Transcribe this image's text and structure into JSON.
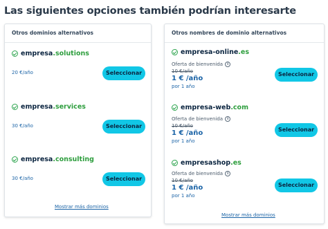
{
  "page": {
    "title": "Las siguientes opciones también podrían interesarte"
  },
  "colors": {
    "accent_button": "#11c7e6",
    "tld_green": "#2e9e3e",
    "link_blue": "#1a63a6",
    "check_green": "#2da44e"
  },
  "left_card": {
    "header": "Otros dominios alternativos",
    "items": [
      {
        "name": "empresa",
        "tld": ".solutions",
        "price": "20 €/año",
        "button": "Seleccionar",
        "icon": "check-circle-icon"
      },
      {
        "name": "empresa",
        "tld": ".services",
        "price": "30 €/año",
        "button": "Seleccionar",
        "icon": "check-circle-icon"
      },
      {
        "name": "empresa",
        "tld": ".consulting",
        "price": "30 €/año",
        "button": "Seleccionar",
        "icon": "check-circle-icon"
      }
    ],
    "more_link": "Mostrar más dominios"
  },
  "right_card": {
    "header": "Otros nombres de dominio alternativos",
    "items": [
      {
        "name": "empresa-online",
        "tld": ".es",
        "offer": "Oferta de bienvenida",
        "old_price": "10 €/año",
        "price": "1 € /año",
        "period": "por 1 año",
        "button": "Seleccionar",
        "icon": "check-circle-icon"
      },
      {
        "name": "empresa-web",
        "tld": ".com",
        "offer": "Oferta de bienvenida",
        "old_price": "10 €/año",
        "price": "1 € /año",
        "period": "por 1 año",
        "button": "Seleccionar",
        "icon": "check-circle-icon"
      },
      {
        "name": "empresashop",
        "tld": ".es",
        "offer": "Oferta de bienvenida",
        "old_price": "10 €/año",
        "price": "1 € /año",
        "period": "por 1 año",
        "button": "Seleccionar",
        "icon": "check-circle-icon"
      }
    ],
    "more_link": "Mostrar más dominios"
  }
}
